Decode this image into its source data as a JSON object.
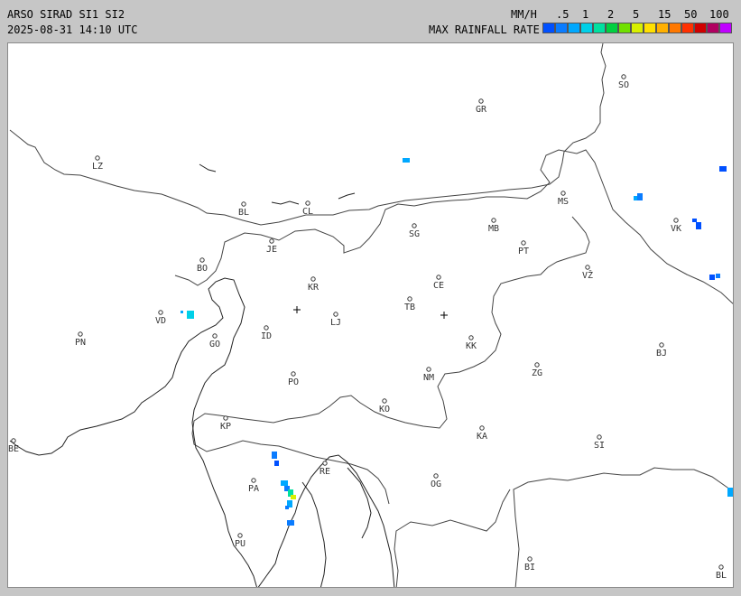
{
  "header": {
    "title": "ARSO SIRAD SI1 SI2",
    "timestamp": "2025-08-31 14:10 UTC",
    "unit": "MM/H",
    "legend_title": "MAX RAINFALL RATE"
  },
  "legend": {
    "ticks": [
      ".5",
      "1",
      "2",
      "5",
      "15",
      "50",
      "100"
    ],
    "colors": [
      "#0050ff",
      "#0a7cff",
      "#00a8ff",
      "#00d0e8",
      "#00e0a0",
      "#00d040",
      "#70e000",
      "#d8f000",
      "#ffe000",
      "#ffb000",
      "#ff7800",
      "#ff3000",
      "#d00000",
      "#b00060",
      "#c000ff"
    ]
  },
  "places": [
    {
      "code": "SO"
    },
    {
      "code": "GR"
    },
    {
      "code": "LZ"
    },
    {
      "code": "BL"
    },
    {
      "code": "CL"
    },
    {
      "code": "MS"
    },
    {
      "code": "MB"
    },
    {
      "code": "VK"
    },
    {
      "code": "JE"
    },
    {
      "code": "SG"
    },
    {
      "code": "PT"
    },
    {
      "code": "BO"
    },
    {
      "code": "KR"
    },
    {
      "code": "CE"
    },
    {
      "code": "VŽ"
    },
    {
      "code": "TB"
    },
    {
      "code": "VD"
    },
    {
      "code": "LJ"
    },
    {
      "code": "PN"
    },
    {
      "code": "GO"
    },
    {
      "code": "ID"
    },
    {
      "code": "KK"
    },
    {
      "code": "BJ"
    },
    {
      "code": "PO"
    },
    {
      "code": "NM"
    },
    {
      "code": "ZG"
    },
    {
      "code": "KO"
    },
    {
      "code": "KP"
    },
    {
      "code": "KA"
    },
    {
      "code": "BE"
    },
    {
      "code": "SI"
    },
    {
      "code": "RE"
    },
    {
      "code": "PA"
    },
    {
      "code": "OG"
    },
    {
      "code": "PU"
    },
    {
      "code": "BI"
    },
    {
      "code": "BL"
    }
  ],
  "colors": {
    "background": "#c6c6c6",
    "map": "#ffffff"
  }
}
